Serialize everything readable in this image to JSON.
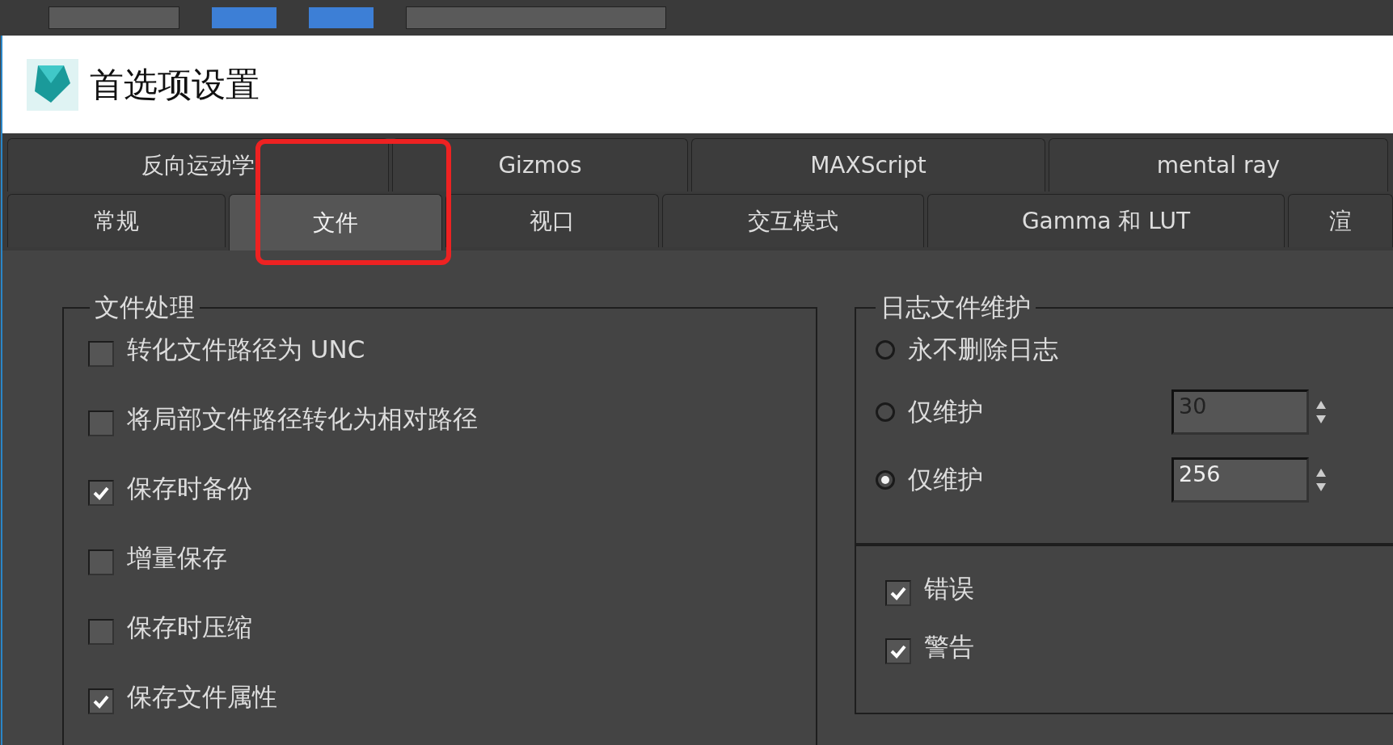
{
  "window": {
    "title": "首选项设置"
  },
  "tab_rows": [
    [
      {
        "label": "反向运动学",
        "selected": false
      },
      {
        "label": "Gizmos",
        "selected": false
      },
      {
        "label": "MAXScript",
        "selected": false
      },
      {
        "label": "mental ray",
        "selected": false
      }
    ],
    [
      {
        "label": "常规",
        "selected": false
      },
      {
        "label": "文件",
        "selected": true
      },
      {
        "label": "视口",
        "selected": false
      },
      {
        "label": "交互模式",
        "selected": false
      },
      {
        "label": "Gamma 和 LUT",
        "selected": false
      },
      {
        "label": "渲",
        "selected": false
      }
    ]
  ],
  "file_handling": {
    "title": "文件处理",
    "options": [
      {
        "label": "转化文件路径为 UNC",
        "checked": false
      },
      {
        "label": "将局部文件路径转化为相对路径",
        "checked": false
      },
      {
        "label": "保存时备份",
        "checked": true
      },
      {
        "label": "增量保存",
        "checked": false
      },
      {
        "label": "保存时压缩",
        "checked": false
      },
      {
        "label": "保存文件属性",
        "checked": true
      }
    ]
  },
  "log_maintenance": {
    "title": "日志文件维护",
    "options": [
      {
        "label": "永不删除日志",
        "selected": false
      },
      {
        "label": "仅维护",
        "selected": false,
        "value": "30",
        "disabled": true
      },
      {
        "label": "仅维护",
        "selected": true,
        "value": "256",
        "disabled": false
      }
    ],
    "levels": [
      {
        "label": "错误",
        "checked": true
      },
      {
        "label": "警告",
        "checked": true
      }
    ]
  }
}
